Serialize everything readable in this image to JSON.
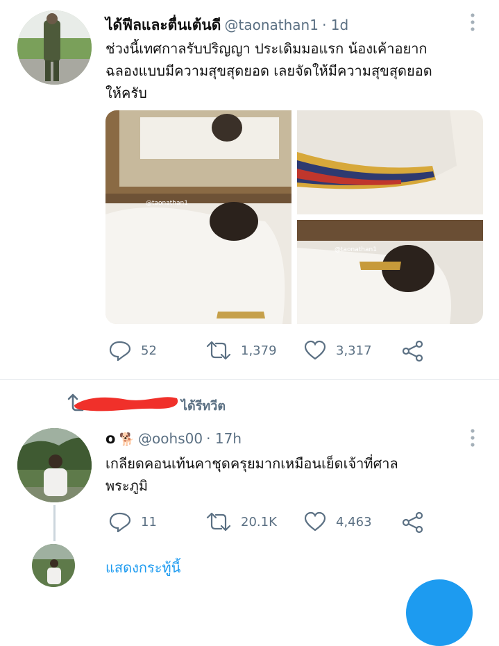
{
  "tweet1": {
    "display_name": "ได้ฟีลและตื่นเต้นดี",
    "handle": "@taonathan1",
    "time": "· 1d",
    "text_line1": "ช่วงนี้เทศกาลรับปริญญา ประเดิมมอแรก น้องเค้าอยาก",
    "text_line2": "ฉลองแบบมีความสุขสุดยอด เลยจัดให้มีความสุขสุดยอด",
    "text_line3": "ให้ครับ",
    "watermark": "@taonathan1",
    "replies": "52",
    "retweets": "1,379",
    "likes": "3,317"
  },
  "retweet_banner": {
    "label": "ได้รีทวีต"
  },
  "tweet2": {
    "display_name": "o",
    "emoji": "🐕",
    "handle": "@oohs00",
    "time": "· 17h",
    "text_line1": "เกลียดคอนเท้นคาชุดครุยมากเหมือนเย็ดเจ้าที่ศาล",
    "text_line2": "พระภูมิ",
    "replies": "11",
    "retweets": "20.1K",
    "likes": "4,463"
  },
  "thread": {
    "show_label": "แสดงกระทู้นี้"
  },
  "icons": {
    "reply": "reply-icon",
    "retweet": "retweet-icon",
    "like": "heart-icon",
    "share": "share-icon",
    "more": "more-vertical-icon"
  },
  "colors": {
    "accent": "#1d9bf0",
    "meta": "#5b7083",
    "redaction": "#f0302a"
  }
}
